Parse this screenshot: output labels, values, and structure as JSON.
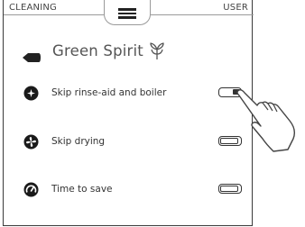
{
  "topbar": {
    "left_tab": "CLEANING",
    "right_tab": "USER"
  },
  "header": {
    "title": "Green Spirit"
  },
  "options": [
    {
      "label": "Skip rinse-aid and boiler",
      "enabled": true
    },
    {
      "label": "Skip drying",
      "enabled": false
    },
    {
      "label": "Time to save",
      "enabled": false
    }
  ],
  "icons": {
    "menu": "hamburger-icon",
    "back": "back-arrow-icon",
    "leaf": "leaf-icon",
    "rinse": "sparkle-icon",
    "drying": "fan-icon",
    "time": "gauge-icon",
    "pointer": "hand-pointer-icon"
  },
  "colors": {
    "text": "#333333",
    "icon": "#1a1a1a",
    "frame": "#3a3a3a"
  }
}
